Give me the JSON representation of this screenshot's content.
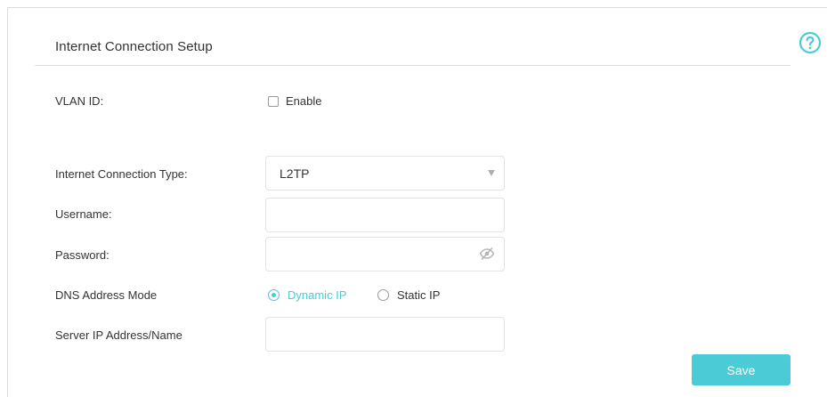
{
  "page": {
    "section_title": "Internet Connection Setup",
    "help_icon": "help-circle-icon",
    "accent_color": "#4acbd6"
  },
  "vlan": {
    "label": "VLAN ID:",
    "checkbox_label": "Enable",
    "checked": false
  },
  "connection_type": {
    "label": "Internet Connection Type:",
    "selected": "L2TP"
  },
  "username": {
    "label": "Username:",
    "value": ""
  },
  "password": {
    "label": "Password:",
    "value": "",
    "visibility_icon": "eye-slash-icon"
  },
  "dns_mode": {
    "label": "DNS Address Mode",
    "options": [
      {
        "label": "Dynamic IP",
        "selected": true
      },
      {
        "label": "Static IP",
        "selected": false
      }
    ]
  },
  "server": {
    "label": "Server IP Address/Name",
    "value": ""
  },
  "actions": {
    "save_label": "Save"
  }
}
